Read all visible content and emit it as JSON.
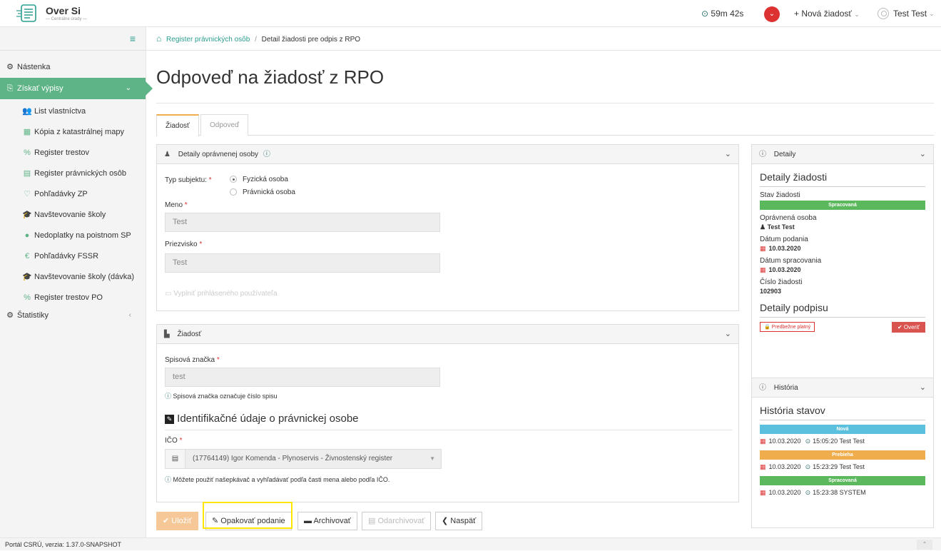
{
  "app": {
    "title": "Over Si",
    "subtitle": "— Centrálne úrady —"
  },
  "topbar": {
    "timer": "59m 42s",
    "notif_icon": "chevron-down",
    "new_request": "+ Nová žiadosť",
    "user": "Test Test"
  },
  "sidebar": {
    "toggle_icon": "≡",
    "items": [
      {
        "label": "Nástenka",
        "icon": "⚙"
      },
      {
        "label": "Získať výpisy",
        "icon": "⎘",
        "active": true
      },
      {
        "label": "List vlastníctva",
        "icon": "👥"
      },
      {
        "label": "Kópia z katastrálnej mapy",
        "icon": "▦"
      },
      {
        "label": "Register trestov",
        "icon": "%"
      },
      {
        "label": "Register právnických osôb",
        "icon": "▤"
      },
      {
        "label": "Pohľadávky ZP",
        "icon": "♡"
      },
      {
        "label": "Navštevovanie školy",
        "icon": "🎓"
      },
      {
        "label": "Nedoplatky na poistnom SP",
        "icon": "●"
      },
      {
        "label": "Pohľadávky FSSR",
        "icon": "€"
      },
      {
        "label": "Navštevovanie školy (dávka)",
        "icon": "🎓"
      },
      {
        "label": "Register trestov PO",
        "icon": "%"
      },
      {
        "label": "Štatistiky",
        "icon": "⚙"
      }
    ]
  },
  "breadcrumb": {
    "parent": "Register právnických osôb",
    "current": "Detail žiadosti pre odpis z RPO"
  },
  "page_title": "Odpoveď na žiadosť z RPO",
  "tabs": [
    {
      "label": "Žiadosť"
    },
    {
      "label": "Odpoveď"
    }
  ],
  "person_panel": {
    "title": "Detaily oprávnenej osoby",
    "subject_type_label": "Typ subjektu:",
    "radio_natural": "Fyzická osoba",
    "radio_legal": "Právnická osoba",
    "radio_selected": "Fyzická osoba",
    "first_name_label": "Meno",
    "first_name_value": "Test",
    "last_name_label": "Priezvisko",
    "last_name_value": "Test",
    "fill_user_link": "Vyplniť prihláseného používateľa"
  },
  "request_panel": {
    "title": "Žiadosť",
    "file_mark_label": "Spisová značka",
    "file_mark_value": "test",
    "file_mark_help": "Spisová značka označuje číslo spisu",
    "legal_section_title": "Identifikačné údaje o právnickej osobe",
    "ico_label": "IČO",
    "ico_value": "(17764149) Igor Komenda - Plynoservis - Živnostenský register",
    "ico_help": "Môžete použiť našepkávač a vyhľadávať podľa časti mena alebo podľa IČO."
  },
  "buttons": {
    "save": "Uložiť",
    "repeat": "Opakovať podanie",
    "archive": "Archivovať",
    "unarchive": "Odarchivovať",
    "back": "Naspäť"
  },
  "details_panel": {
    "title": "Detaily",
    "heading": "Detaily žiadosti",
    "status_label": "Stav žiadosti",
    "status_value": "Spracovaná",
    "status_color": "#5cb85c",
    "person_label": "Oprávnená osoba",
    "person_value": "Test Test",
    "submitted_label": "Dátum podania",
    "submitted_value": "10.03.2020",
    "processed_label": "Dátum spracovania",
    "processed_value": "10.03.2020",
    "number_label": "Číslo žiadosti",
    "number_value": "102903",
    "signature_heading": "Detaily podpisu",
    "signature_badge": "Predbežne platný",
    "verify_button": "Overiť"
  },
  "history_panel": {
    "title": "História",
    "heading": "História stavov",
    "entries": [
      {
        "status": "Nová",
        "color": "#5bc0de",
        "date": "10.03.2020",
        "time": "15:05:20",
        "user": "Test Test"
      },
      {
        "status": "Prebieha",
        "color": "#f0ad4e",
        "date": "10.03.2020",
        "time": "15:23:29",
        "user": "Test Test"
      },
      {
        "status": "Spracovaná",
        "color": "#5cb85c",
        "date": "10.03.2020",
        "time": "15:23:38",
        "user": "SYSTEM"
      }
    ]
  },
  "footer": {
    "text": "Portál CSRÚ, verzia: 1.37.0-SNAPSHOT"
  }
}
